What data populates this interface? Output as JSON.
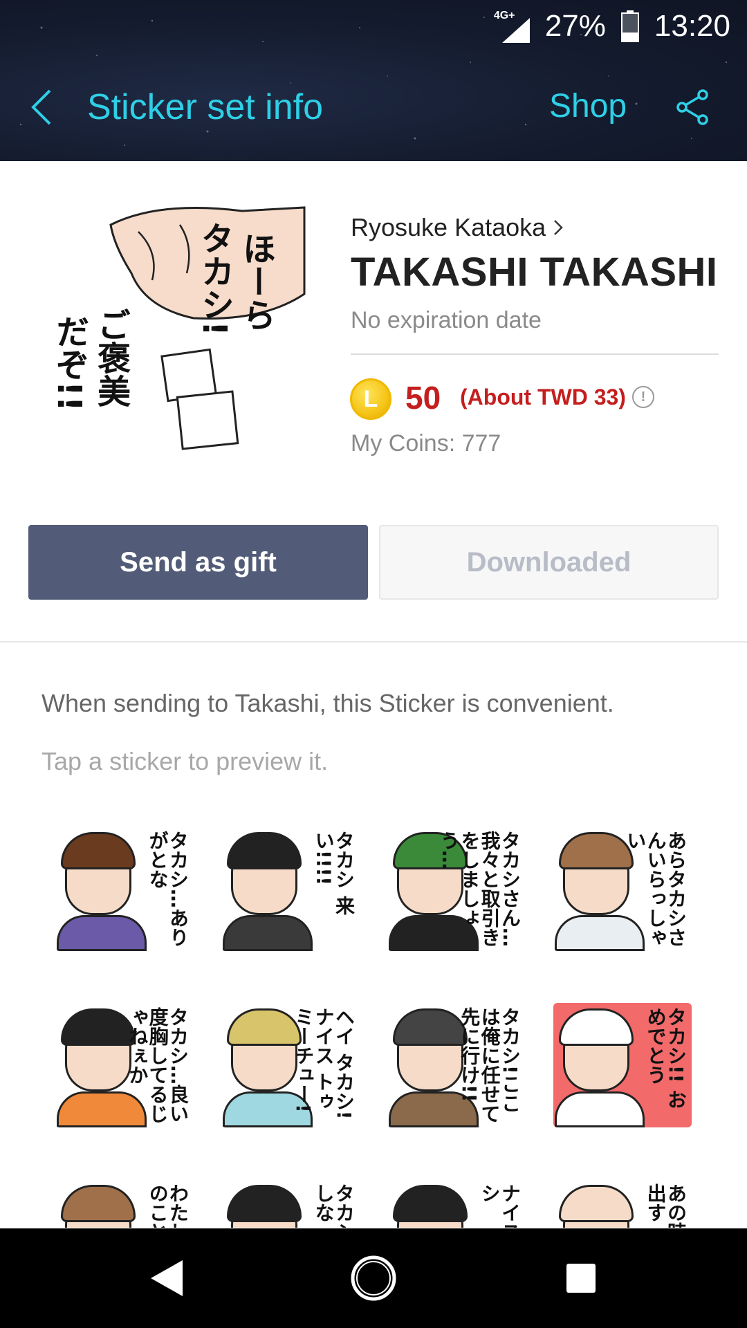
{
  "status_bar": {
    "network": "4G+",
    "battery": "27%",
    "time": "13:20"
  },
  "topbar": {
    "title": "Sticker set info",
    "shop_label": "Shop"
  },
  "sticker_set": {
    "author": "Ryosuke Kataoka",
    "title": "TAKASHI TAKASHI",
    "expiry": "No expiration date",
    "coin_symbol": "L",
    "price": "50",
    "price_approx": "(About TWD 33)",
    "my_coins": "My Coins: 777",
    "main_sticker_text": [
      "ほーら",
      "タカシ!",
      "ご褒美",
      "だぞ!!"
    ]
  },
  "actions": {
    "gift_label": "Send as gift",
    "downloaded_label": "Downloaded"
  },
  "description": "When sending to Takashi, this Sticker is convenient.",
  "hint": "Tap a sticker to preview it.",
  "stickers": [
    {
      "text": "タカシ…ありがとな",
      "hair": "#6b3b1f",
      "shirt": "#6a5aa8",
      "bg": "#ffffff"
    },
    {
      "text": "タカシ 来い!!!!",
      "hair": "#222222",
      "shirt": "#3a3a3a",
      "bg": "#ffffff"
    },
    {
      "text": "タカシさん…我々と取引きをしましょう…",
      "hair": "#3a8a3a",
      "shirt": "#222222",
      "bg": "#ffffff"
    },
    {
      "text": "あらタカシさんいらっしゃい",
      "hair": "#a0704a",
      "shirt": "#e8eef2",
      "bg": "#ffffff"
    },
    {
      "text": "タカシ…良い度胸してるじゃねぇか",
      "hair": "#222222",
      "shirt": "#f08a3a",
      "bg": "#ffffff"
    },
    {
      "text": "ヘイ タカシ!ナイス トゥ ミーチュー!",
      "hair": "#d8c46a",
      "shirt": "#9fd8e0",
      "bg": "#ffffff"
    },
    {
      "text": "タカシ!ここは俺に任せて先に行け!!",
      "hair": "#444444",
      "shirt": "#8a6a4a",
      "bg": "#ffffff"
    },
    {
      "text": "タカシ!! おめでとう",
      "hair": "#ffffff",
      "shirt": "#ffffff",
      "bg": "#f26a6a"
    },
    {
      "text": "わたしタカシのこと",
      "hair": "#a0704a",
      "shirt": "#ffffff",
      "bg": "#ffffff"
    },
    {
      "text": "タカシ そこしな",
      "hair": "#222222",
      "shirt": "#ffffff",
      "bg": "#ffffff"
    },
    {
      "text": "ナイス タカシ",
      "hair": "#222222",
      "shirt": "#ffffff",
      "bg": "#ffffff"
    },
    {
      "text": "あの時 思い出す タカシ",
      "hair": "#f6dcc8",
      "shirt": "#ffffff",
      "bg": "#ffffff"
    }
  ],
  "icons": {
    "back": "chevron-left-icon",
    "share": "share-icon",
    "info": "info-icon",
    "coin": "line-coin-icon"
  },
  "colors": {
    "accent": "#2ed0e6",
    "price": "#c41e1e",
    "gift_button": "#525c78"
  }
}
